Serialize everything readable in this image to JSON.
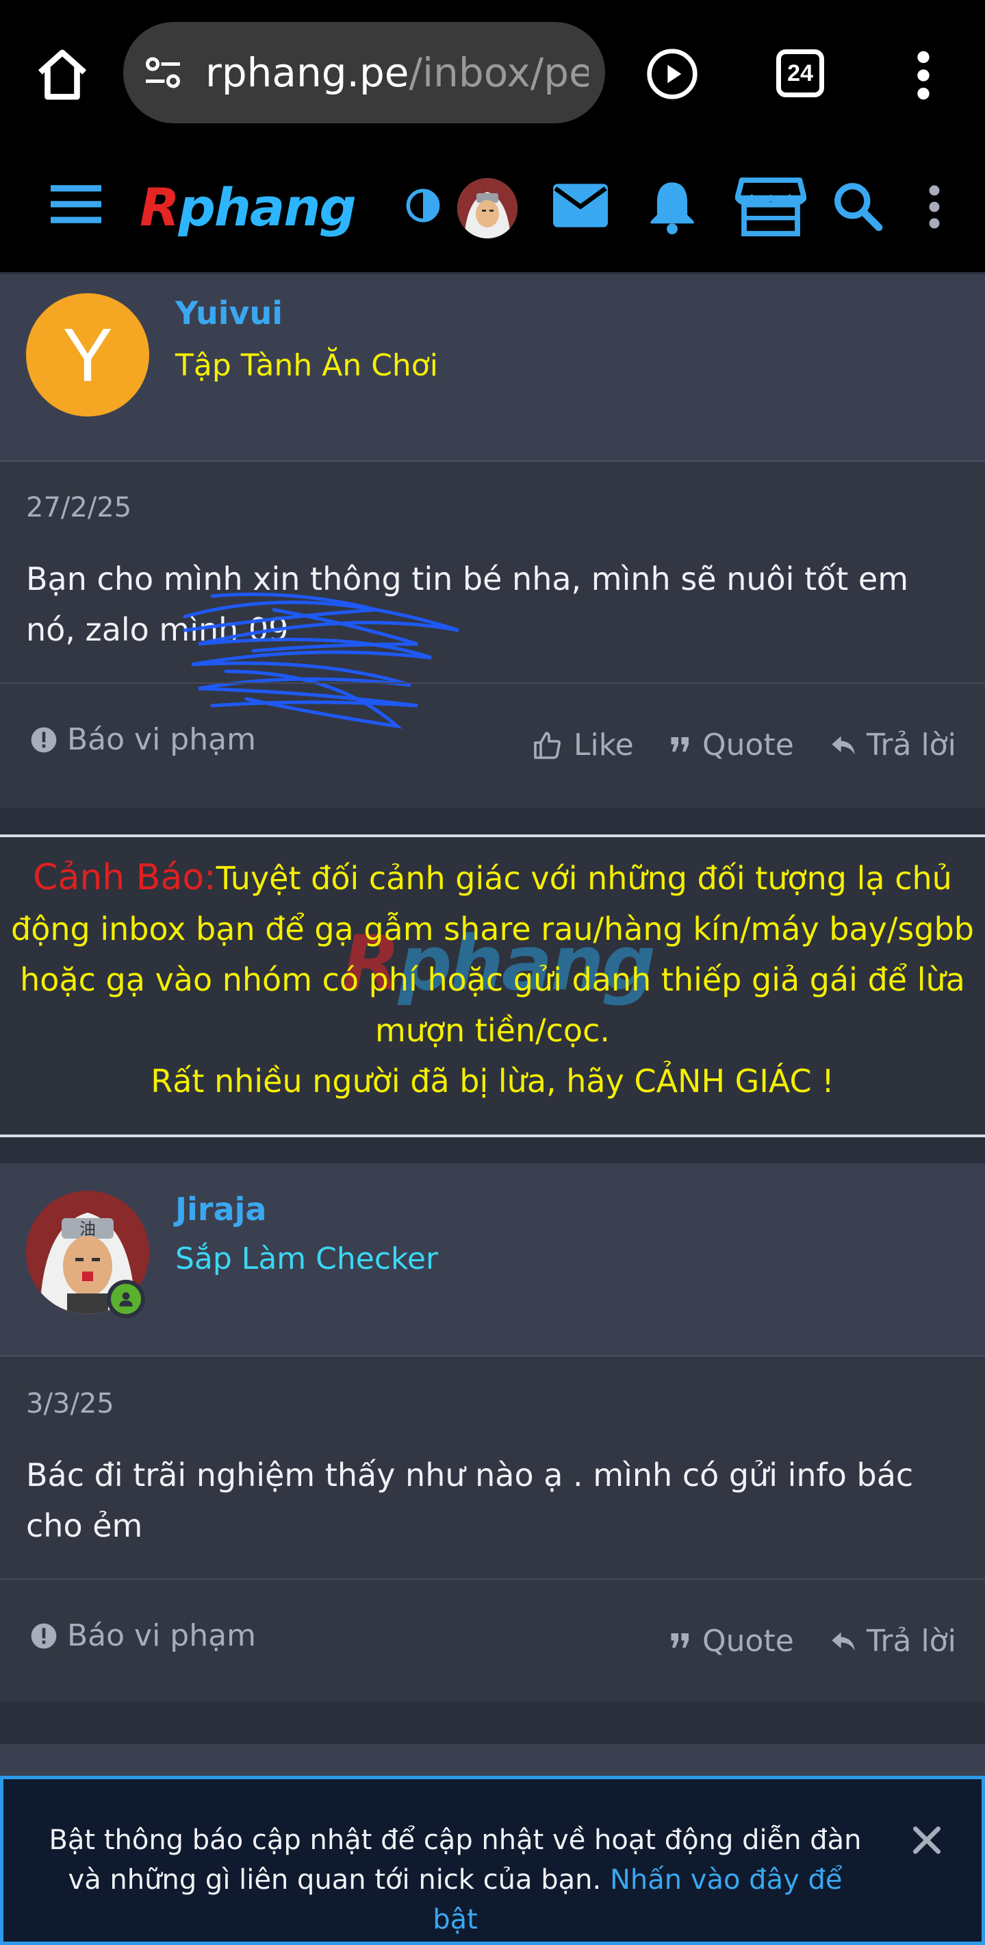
{
  "browser": {
    "url_host": "rphang.pe",
    "url_path": "/inbox/pe-",
    "tab_count": "24"
  },
  "site": {
    "logo_r": "R",
    "logo_rest": "phang"
  },
  "posts": [
    {
      "username": "Yuivui",
      "avatar_letter": "Y",
      "user_title": "Tập Tành Ăn Chơi",
      "user_title_color": "#f5f000",
      "date": "27/2/25",
      "body": "Bạn cho mình xin thông tin bé nha, mình sẽ nuôi tốt em nó, zalo mình 09",
      "report_label": "Báo vi phạm",
      "like_label": "Like",
      "quote_label": "Quote",
      "reply_label": "Trả lời"
    },
    {
      "username": "Jiraja",
      "user_title": "Sắp Làm Checker",
      "user_title_color": "#3ad8f5",
      "date": "3/3/25",
      "body": "Bác đi trãi nghiệm thấy như nào ạ . mình có gửi info bác cho ẻm",
      "report_label": "Báo vi phạm",
      "quote_label": "Quote",
      "reply_label": "Trả lời"
    }
  ],
  "warning": {
    "label": "Cảnh Báo:",
    "text": "Tuyệt đối cảnh giác với những đối tượng lạ chủ động inbox bạn để gạ gẫm share rau/hàng kín/máy bay/sgbb hoặc gạ vào nhóm có phí hoặc gửi danh thiếp giả gái để lừa mượn tiền/cọc.",
    "line2": "Rất nhiều người đã bị lừa, hãy CẢNH GIÁC !"
  },
  "notification": {
    "text": "Bật thông báo cập nhật để cập nhật về hoạt động diễn đàn và những gì liên quan tới nick của bạn. ",
    "link": "Nhấn vào đây để bật"
  },
  "colors": {
    "accent": "#3aa8f0",
    "warning_text": "#f5f000",
    "warning_label": "#e02020",
    "avatar_yellow": "#f5a623",
    "online": "#5bb12f"
  }
}
